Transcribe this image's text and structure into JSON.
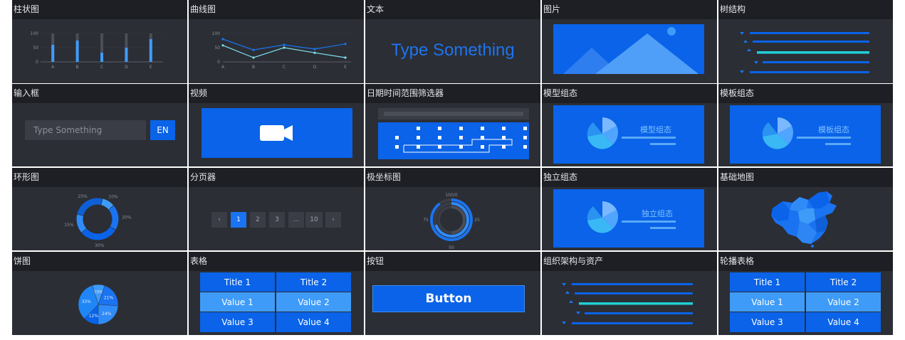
{
  "colors": {
    "accent": "#0a63e8",
    "light_blue": "#3f9bf8",
    "teal": "#20d0d6",
    "tile_bg": "#2b2e35",
    "title_bg": "#1d1f24"
  },
  "tiles": {
    "bar": {
      "title": "柱状图"
    },
    "curve": {
      "title": "曲线图"
    },
    "text": {
      "title": "文本",
      "content": "Type Something"
    },
    "image": {
      "title": "图片"
    },
    "tree": {
      "title": "树结构"
    },
    "input": {
      "title": "输入框",
      "placeholder": "Type Something",
      "button": "EN"
    },
    "video": {
      "title": "视频"
    },
    "daterange": {
      "title": "日期时间范围筛选器"
    },
    "model": {
      "title": "模型组态",
      "label": "模型组态"
    },
    "template": {
      "title": "模板组态",
      "label": "模板组态"
    },
    "ring": {
      "title": "环形图"
    },
    "pager": {
      "title": "分页器",
      "prev": "‹",
      "next": "›",
      "pages": [
        "1",
        "2",
        "3",
        "...",
        "10"
      ],
      "active": "1"
    },
    "polar": {
      "title": "极坐标图"
    },
    "standalone": {
      "title": "独立组态",
      "label": "独立组态"
    },
    "map": {
      "title": "基础地图"
    },
    "pie": {
      "title": "饼图"
    },
    "table": {
      "title": "表格",
      "headers": [
        "Title 1",
        "Title 2"
      ],
      "rows": [
        [
          "Value 1",
          "Value 2"
        ],
        [
          "Value 3",
          "Value 4"
        ]
      ]
    },
    "button": {
      "title": "按钮",
      "label": "Button"
    },
    "org": {
      "title": "组织架构与资产"
    },
    "carousel": {
      "title": "轮播表格",
      "headers": [
        "Title 1",
        "Title 2"
      ],
      "rows": [
        [
          "Value 1",
          "Value 2"
        ],
        [
          "Value 3",
          "Value 4"
        ]
      ]
    }
  },
  "chart_data": [
    {
      "type": "bar",
      "categories": [
        "A",
        "B",
        "C",
        "D",
        "E"
      ],
      "values": [
        60,
        75,
        32,
        50,
        80
      ],
      "ylim": [
        0,
        100
      ],
      "yticks": [
        "100",
        "50",
        "0"
      ]
    },
    {
      "type": "line",
      "categories": [
        "A",
        "B",
        "C",
        "D",
        "E"
      ],
      "series": [
        {
          "values": [
            80,
            42,
            60,
            45,
            63
          ]
        },
        {
          "values": [
            58,
            15,
            50,
            32,
            15
          ]
        }
      ],
      "ylim": [
        0,
        100
      ],
      "yticks": [
        "100",
        "50",
        "0"
      ]
    },
    {
      "type": "pie",
      "style": "donut",
      "labels": [
        "10%",
        "20%",
        "30%",
        "15%",
        "25%"
      ],
      "values": [
        10,
        20,
        30,
        15,
        25
      ]
    },
    {
      "type": "pie",
      "labels": [
        "10%",
        "21%",
        "24%",
        "12%",
        "33%"
      ],
      "values": [
        10,
        21,
        24,
        12,
        33
      ]
    },
    {
      "type": "polar",
      "labels": [
        "100/0",
        "25",
        "50",
        "75"
      ],
      "values": [
        90,
        70,
        50
      ]
    }
  ]
}
